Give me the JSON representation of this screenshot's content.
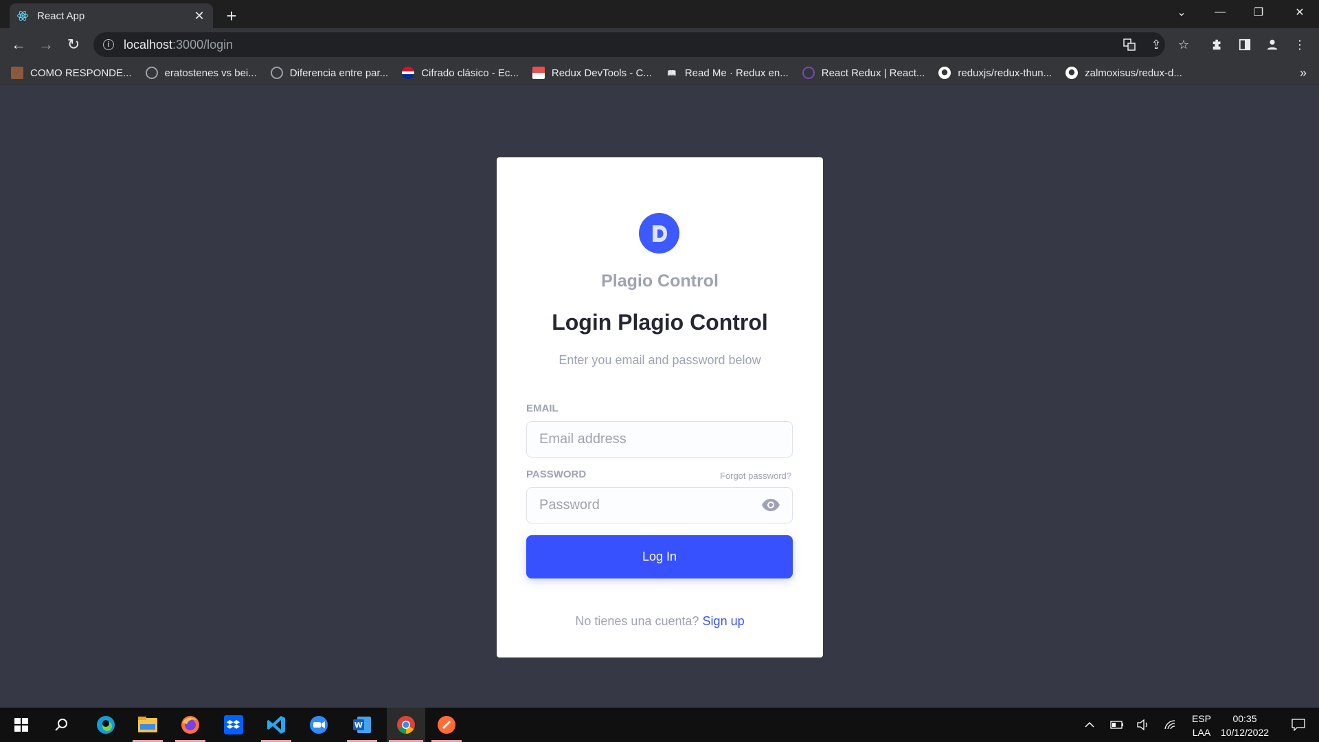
{
  "browser": {
    "tab_title": "React App",
    "url_host": "localhost",
    "url_path": ":3000/login",
    "bookmarks": [
      {
        "label": "COMO RESPONDE...",
        "icon": "photo-icon",
        "color": "#8b5a3c"
      },
      {
        "label": "eratostenes vs bei...",
        "icon": "globe-icon",
        "color": "#9aa0a6"
      },
      {
        "label": "Diferencia entre par...",
        "icon": "globe-icon",
        "color": "#9aa0a6"
      },
      {
        "label": "Cifrado clásico - Ec...",
        "icon": "cuba-flag-icon",
        "color": "#cf142b"
      },
      {
        "label": "Redux DevTools - C...",
        "icon": "store-icon",
        "color": "#e94f4f"
      },
      {
        "label": "Read Me · Redux en...",
        "icon": "book-icon",
        "color": "#e8eaed"
      },
      {
        "label": "React Redux | React...",
        "icon": "redux-icon",
        "color": "#764abc"
      },
      {
        "label": "reduxjs/redux-thun...",
        "icon": "github-icon",
        "color": "#ffffff"
      },
      {
        "label": "zalmoxisus/redux-d...",
        "icon": "github-icon",
        "color": "#ffffff"
      }
    ],
    "more_bookmarks": "»"
  },
  "login": {
    "brand": "Plagio Control",
    "heading": "Login Plagio Control",
    "subheading": "Enter you email and password below",
    "email_label": "EMAIL",
    "email_placeholder": "Email address",
    "email_value": "",
    "password_label": "PASSWORD",
    "forgot_label": "Forgot password?",
    "password_placeholder": "Password",
    "password_value": "",
    "login_button": "Log In",
    "no_account": "No tienes una cuenta?",
    "signup_link": "Sign up",
    "accent_color": "#3751ff"
  },
  "taskbar": {
    "language_top": "ESP",
    "language_bottom": "LAA",
    "time": "00:35",
    "date": "10/12/2022"
  }
}
